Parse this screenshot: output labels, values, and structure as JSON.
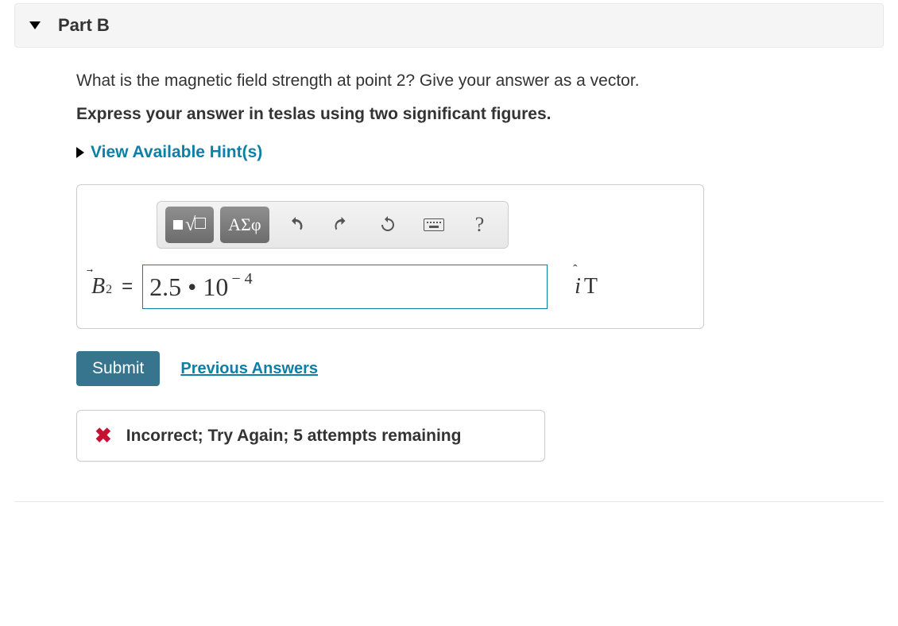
{
  "part": {
    "title": "Part B"
  },
  "question": "What is the magnetic field strength at point 2? Give your answer as a vector.",
  "instruction": "Express your answer in teslas using two significant figures.",
  "hints": {
    "label": "View Available Hint(s)"
  },
  "toolbar": {
    "templates_label": "∎√☐",
    "symbols_label": "ΑΣφ",
    "undo": "undo",
    "redo": "redo",
    "reset": "reset",
    "keyboard": "keyboard",
    "help": "?"
  },
  "answer": {
    "variable": "B",
    "subscript": "2",
    "equals": "=",
    "value_base": "2.5 • 10",
    "value_exp": "− 4",
    "unit_vector": "i",
    "unit": "T"
  },
  "actions": {
    "submit": "Submit",
    "previous": "Previous Answers"
  },
  "feedback": {
    "icon": "✖",
    "text": "Incorrect; Try Again; 5 attempts remaining"
  }
}
